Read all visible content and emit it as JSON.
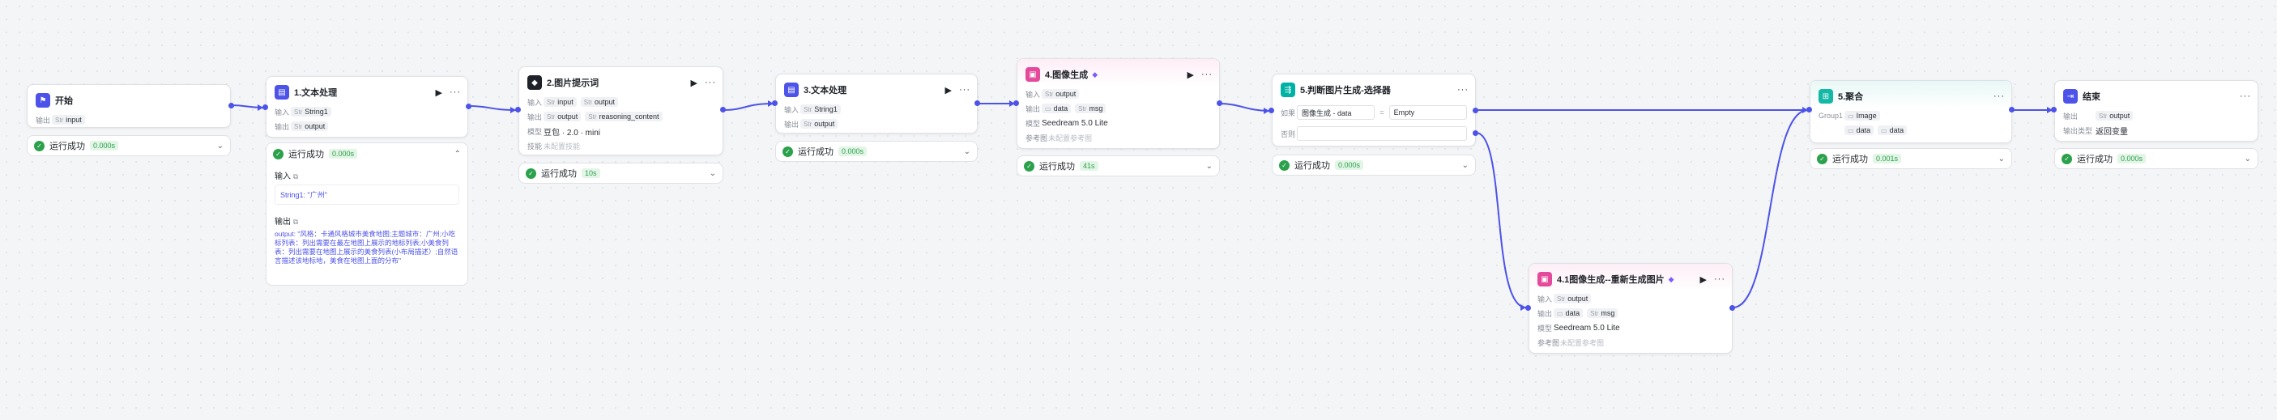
{
  "nodes": {
    "start": {
      "title": "开始",
      "out_label": "输出",
      "var_type": "Str",
      "var": "input"
    },
    "text1": {
      "title": "1.文本处理",
      "in_label": "输入",
      "in_type": "Str",
      "in_var": "String1",
      "out_label": "输出",
      "out_type": "Str",
      "out_var": "output"
    },
    "prompt": {
      "title": "2.图片提示词",
      "in_label": "输入",
      "in_type": "Str",
      "in_var": "input",
      "in_type2": "Str",
      "in_var2": "output",
      "out_label": "输出",
      "out_type": "Str",
      "out_var": "output",
      "out_type2": "Str",
      "out_var2": "reasoning_content",
      "model_label": "模型",
      "model": "豆包 · 2.0 · mini",
      "skill_label": "技能",
      "skill": "未配置技能"
    },
    "text3": {
      "title": "3.文本处理",
      "in_label": "输入",
      "in_type": "Str",
      "in_var": "String1",
      "out_label": "输出",
      "out_type": "Str",
      "out_var": "output"
    },
    "img4": {
      "title": "4.图像生成",
      "in_label": "输入",
      "in_type": "Str",
      "in_var": "output",
      "out_label": "输出",
      "out_var": "data",
      "out_type2": "Str",
      "out_var2": "msg",
      "model_label": "模型",
      "model": "Seedream 5.0 Lite",
      "ref_label": "参考图",
      "ref": "未配置参考图"
    },
    "selector": {
      "title": "5.判断图片生成-选择器",
      "if_label": "如果",
      "left": "图像生成 - data",
      "op": "=",
      "right": "Empty",
      "else_label": "否则"
    },
    "regen": {
      "title": "4.1图像生成--重新生成图片",
      "in_label": "输入",
      "in_type": "Str",
      "in_var": "output",
      "out_label": "输出",
      "out_var": "data",
      "out_type2": "Str",
      "out_var2": "msg",
      "model_label": "模型",
      "model": "Seedream 5.0 Lite",
      "ref_label": "参考图",
      "ref": "未配置参考图"
    },
    "merge": {
      "title": "5.聚合",
      "group_label": "Group1",
      "var": "Image",
      "opt1": "data",
      "opt2": "data"
    },
    "end": {
      "title": "结束",
      "out_label": "输出",
      "out_type": "Str",
      "out_var": "output",
      "type_label": "输出类型",
      "type_val": "返回变量"
    }
  },
  "status": {
    "label": "运行成功",
    "start_time": "0.000s",
    "text1_time": "0.000s",
    "prompt_time": "10s",
    "text3_time": "0.000s",
    "img4_time": "41s",
    "selector_time": "0.000s",
    "merge_time": "0.001s",
    "end_time": "0.000s"
  },
  "expanded": {
    "input_label": "输入",
    "input_value": "String1: \"广州\"",
    "output_label": "输出",
    "output_value": "output: \"风格：卡通风格城市美食地图;主题城市：广州;小吃标列表：列出需要在最左地图上展示的地标列表;小美食列表：列出需要在地图上展示的美食列表(小布局描述）;自然语言描述该地标地，美食在地图上面的分布\""
  },
  "colors": {
    "accent": "#4d53e8",
    "success": "#2ba14c",
    "start_icon": "#4d53e8",
    "text_icon": "#4d53e8",
    "llm_icon": "#1f2329",
    "image_icon": "#e5499b",
    "selector_icon": "#00b2a5",
    "merge_icon": "#14b8a6",
    "end_icon": "#4d53e8"
  },
  "icons": [
    "flag-icon",
    "text-process-icon",
    "llm-icon",
    "image-gen-icon",
    "selector-icon",
    "merge-icon",
    "end-icon",
    "play-icon",
    "more-icon",
    "check-icon",
    "chevron-down-icon",
    "chevron-up-icon",
    "copy-icon",
    "diamond-icon"
  ]
}
